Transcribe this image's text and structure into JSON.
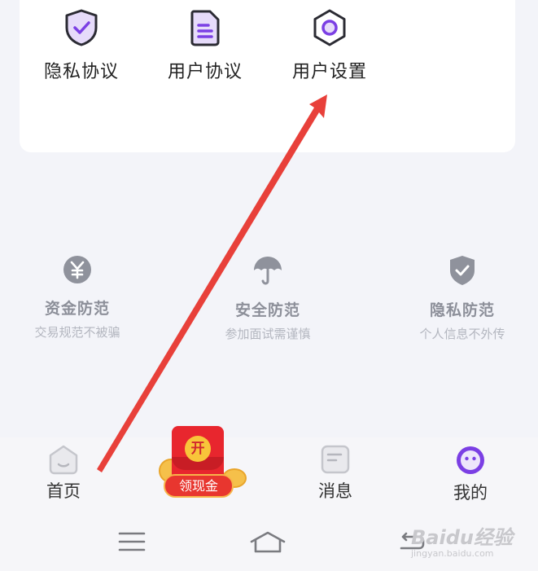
{
  "shortcuts": [
    {
      "label": "隐私协议",
      "icon": "shield-check-icon"
    },
    {
      "label": "用户协议",
      "icon": "document-icon"
    },
    {
      "label": "用户设置",
      "icon": "settings-hexagon-icon"
    }
  ],
  "safety_tips": [
    {
      "title": "资金防范",
      "subtitle": "交易规范不被骗",
      "icon": "yen-coin-icon"
    },
    {
      "title": "安全防范",
      "subtitle": "参加面试需谨慎",
      "icon": "umbrella-icon"
    },
    {
      "title": "隐私防范",
      "subtitle": "个人信息不外传",
      "icon": "shield-check-icon"
    }
  ],
  "tabbar": {
    "home": "首页",
    "cash": {
      "badge": "开",
      "label": "领现金"
    },
    "messages": "消息",
    "mine": "我的"
  },
  "watermark": {
    "brand": "Baidu经验",
    "url": "jingyan.baidu.com"
  },
  "colors": {
    "accent": "#7b3fe4",
    "arrow": "#e8403a",
    "page_bg": "#f3f4f9"
  }
}
